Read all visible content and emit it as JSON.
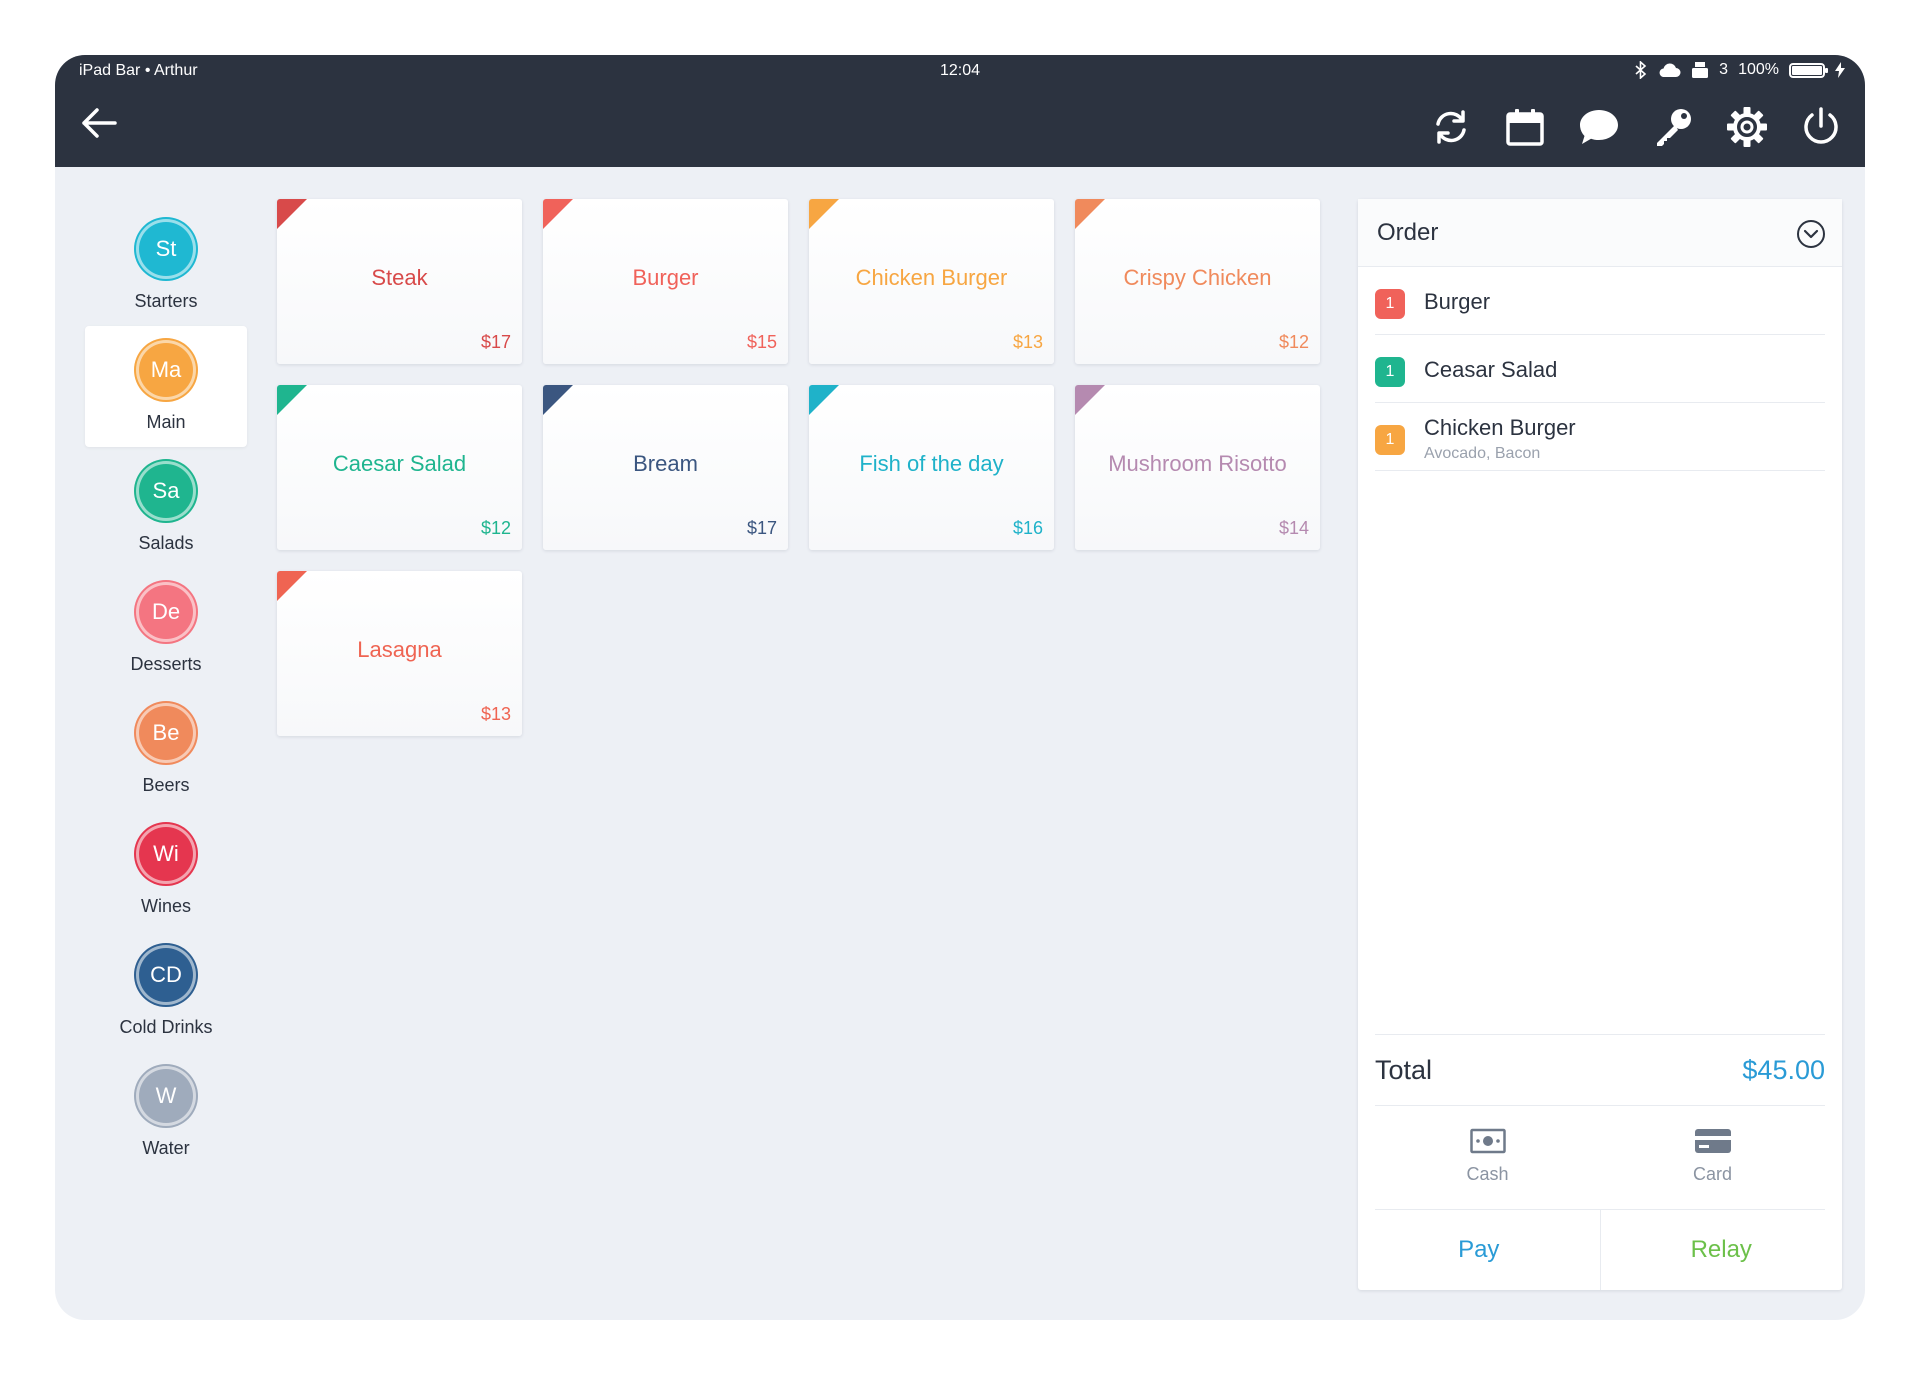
{
  "status_bar": {
    "device": "iPad Bar • Arthur",
    "time": "12:04",
    "printer_count": "3",
    "battery": "100%"
  },
  "toolbar": {
    "icons": [
      "back-arrow-icon",
      "sync-icon",
      "calendar-icon",
      "chat-bubble-icon",
      "key-icon",
      "settings-gear-icon",
      "power-icon"
    ]
  },
  "categories": [
    {
      "abbr": "St",
      "label": "Starters",
      "color": "#1fb8d2"
    },
    {
      "abbr": "Ma",
      "label": "Main",
      "color": "#f7a642",
      "active": true
    },
    {
      "abbr": "Sa",
      "label": "Salads",
      "color": "#1fb58f"
    },
    {
      "abbr": "De",
      "label": "Desserts",
      "color": "#f47581"
    },
    {
      "abbr": "Be",
      "label": "Beers",
      "color": "#f08a5c"
    },
    {
      "abbr": "Wi",
      "label": "Wines",
      "color": "#e5364f"
    },
    {
      "abbr": "CD",
      "label": "Cold Drinks",
      "color": "#2e5f91"
    },
    {
      "abbr": "W",
      "label": "Water",
      "color": "#9fabbc"
    }
  ],
  "products": [
    {
      "name": "Steak",
      "price": "$17",
      "color": "#d84a4a"
    },
    {
      "name": "Burger",
      "price": "$15",
      "color": "#f0625a"
    },
    {
      "name": "Chicken Burger",
      "price": "$13",
      "color": "#f7a642"
    },
    {
      "name": "Crispy Chicken",
      "price": "$12",
      "color": "#f08a5c"
    },
    {
      "name": "Caesar Salad",
      "price": "$12",
      "color": "#1fb58f"
    },
    {
      "name": "Bream",
      "price": "$17",
      "color": "#3b5680"
    },
    {
      "name": "Fish of the day",
      "price": "$16",
      "color": "#1fb2c9"
    },
    {
      "name": "Mushroom Risotto",
      "price": "$14",
      "color": "#b58ab0"
    },
    {
      "name": "Lasagna",
      "price": "$13",
      "color": "#ef6452"
    }
  ],
  "order": {
    "title": "Order",
    "lines": [
      {
        "qty": "1",
        "name": "Burger",
        "sub": "",
        "color": "#f0625a"
      },
      {
        "qty": "1",
        "name": "Ceasar Salad",
        "sub": "",
        "color": "#1fb58f"
      },
      {
        "qty": "1",
        "name": "Chicken Burger",
        "sub": "Avocado, Bacon",
        "color": "#f7a642"
      }
    ],
    "total_label": "Total",
    "total_value": "$45.00",
    "methods": [
      {
        "label": "Cash",
        "icon": "cash-icon"
      },
      {
        "label": "Card",
        "icon": "credit-card-icon"
      }
    ],
    "pay_label": "Pay",
    "relay_label": "Relay",
    "pay_color": "#2a9bd6",
    "relay_color": "#6cc04a"
  }
}
